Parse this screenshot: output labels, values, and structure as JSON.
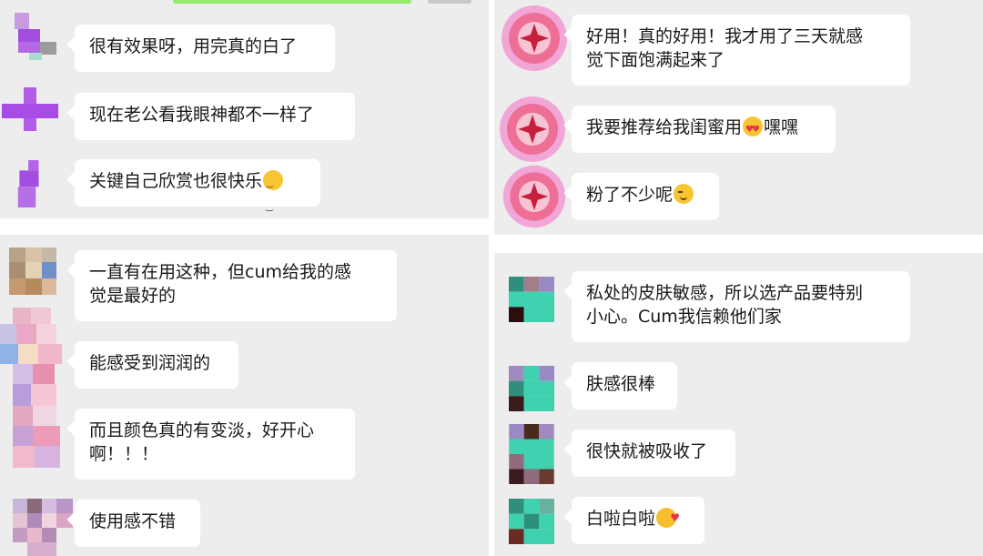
{
  "colors": {
    "chat_bg": "#ededed",
    "bubble": "#ffffff",
    "text": "#191919",
    "sent_bubble": "#95ec69"
  },
  "panel_top_left": {
    "messages": [
      {
        "text": "很有效果呀，用完真的白了"
      },
      {
        "text": "现在老公看我眼神都不一样了"
      },
      {
        "text": "关键自己欣赏也很快乐",
        "emoji": "relieved-face-icon"
      }
    ]
  },
  "panel_bottom_left": {
    "messages": [
      {
        "line1": "一直有在用这种，但cum给我的感",
        "line2": "觉是最好的"
      },
      {
        "text": "能感受到润润的"
      },
      {
        "line1": "而且颜色真的有变淡，好开心",
        "line2": "啊！！！"
      },
      {
        "text": "使用感不错"
      }
    ]
  },
  "panel_top_right": {
    "messages": [
      {
        "line1": "好用！真的好用！我才用了三天就感",
        "line2": "觉下面饱满起来了"
      },
      {
        "text": "我要推荐给我闺蜜用",
        "emoji": "heart-eyes-face-icon",
        "suffix": "嘿嘿"
      },
      {
        "text": "粉了不少呢",
        "emoji": "winking-face-icon"
      }
    ]
  },
  "panel_bottom_right": {
    "messages": [
      {
        "line1": "私处的皮肤敏感，所以选产品要特别",
        "line2": "小心。Cum我信赖他们家"
      },
      {
        "text": "肤感很棒"
      },
      {
        "text": "很快就被吸收了"
      },
      {
        "text": "白啦白啦",
        "emoji": "kissing-heart-face-icon"
      }
    ]
  }
}
